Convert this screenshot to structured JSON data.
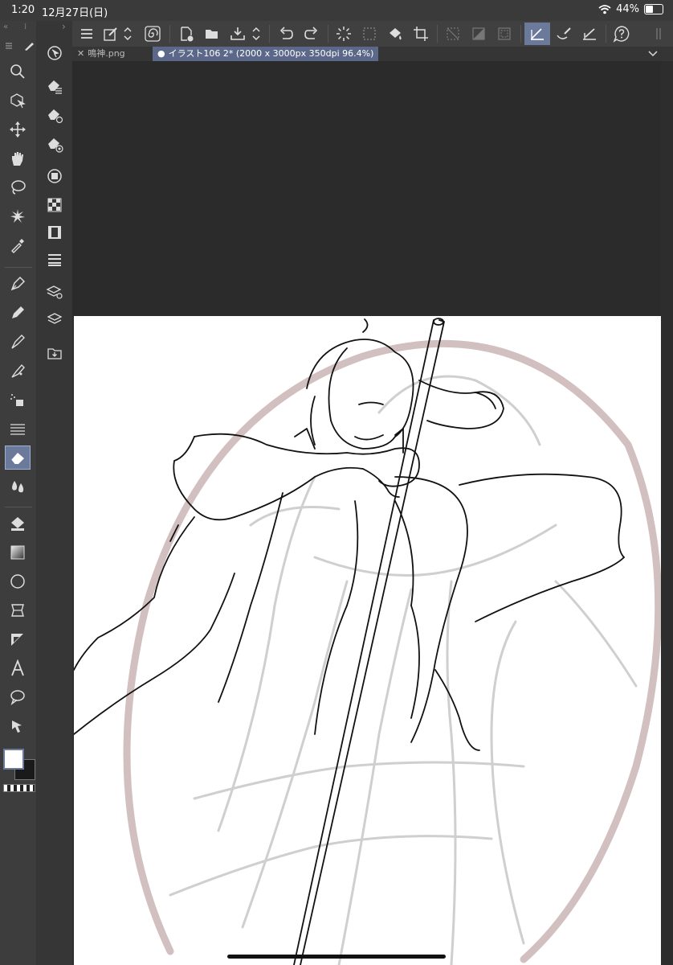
{
  "status": {
    "time": "1:20",
    "date": "12月27日(日)",
    "battery": "44%"
  },
  "tabs": [
    {
      "label": "鳴神.png",
      "active": false
    },
    {
      "label": "イラスト106 2* (2000 x 3000px 350dpi 96.4%)",
      "active": true
    }
  ],
  "canvas": {
    "text": ""
  },
  "colors": {
    "accent": "#6b7a9a",
    "main": "#ffffff",
    "sub": "#1a1a1a",
    "sketch": "#c9b7b7"
  }
}
